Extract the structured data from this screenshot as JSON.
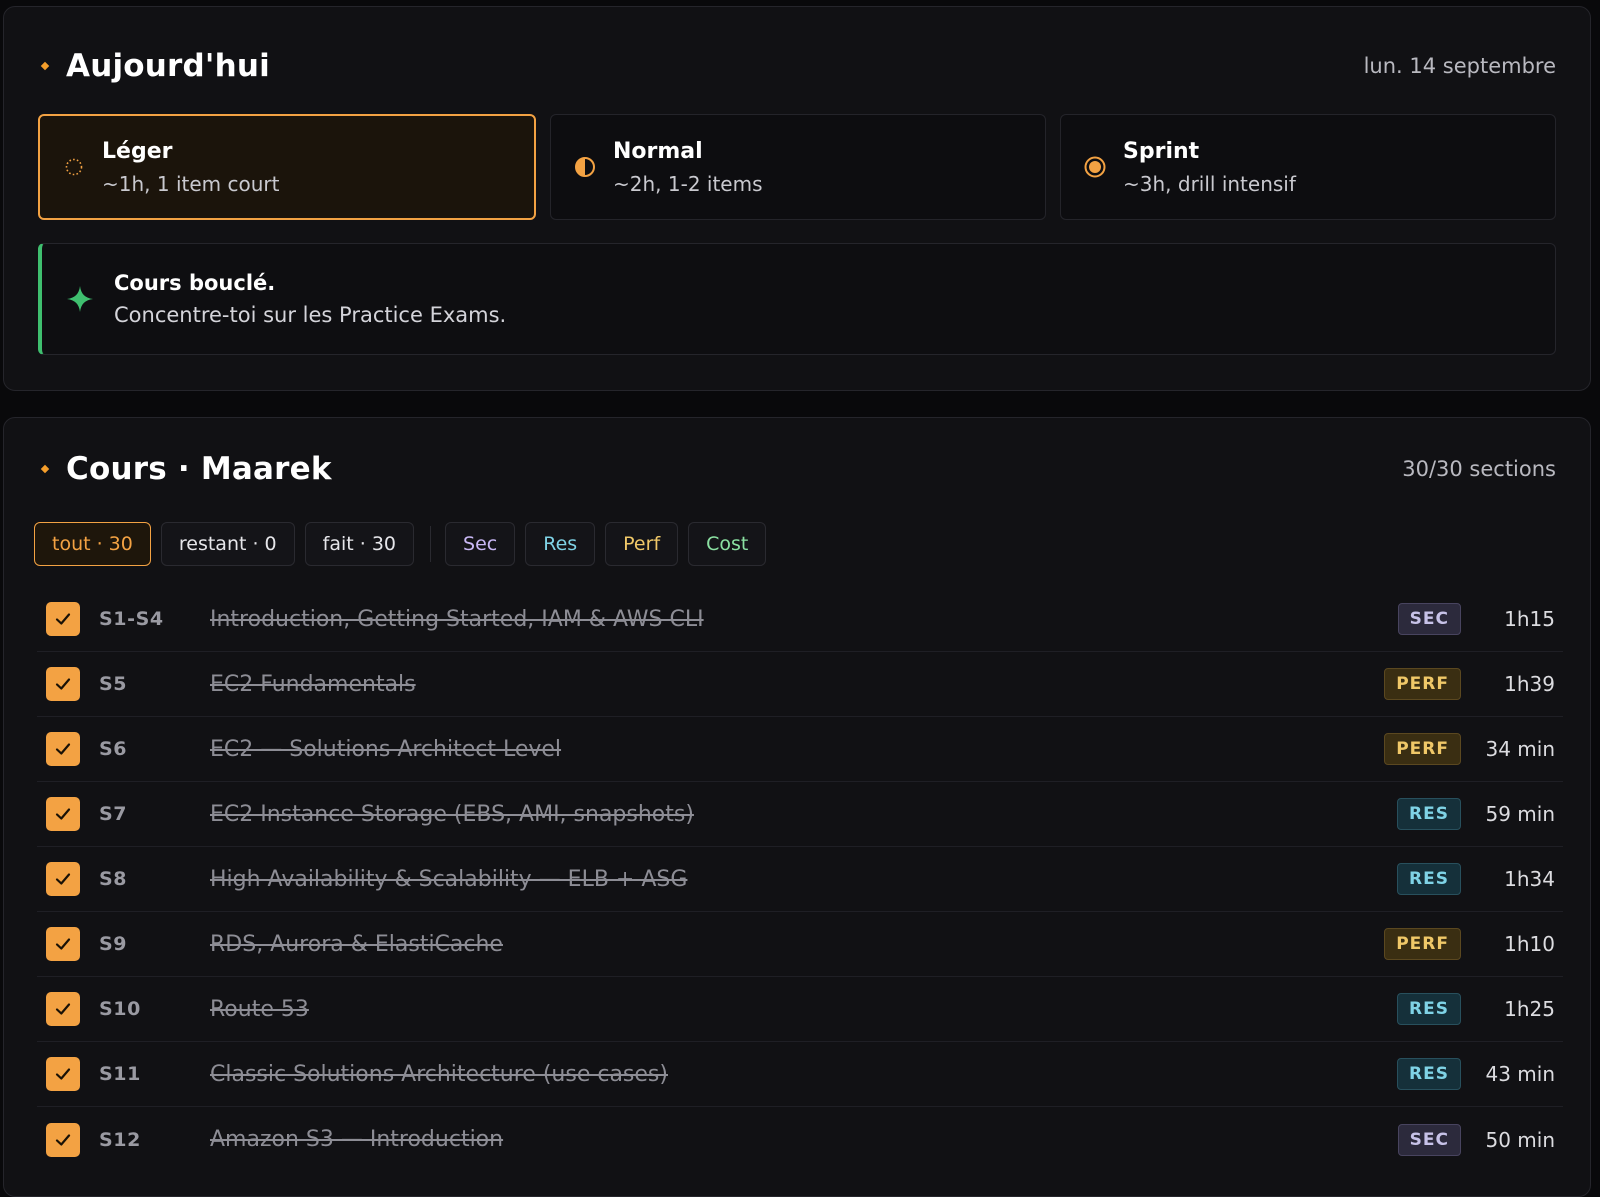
{
  "today": {
    "title": "Aujourd'hui",
    "date": "lun. 14 septembre",
    "modes": [
      {
        "name": "Léger",
        "desc": "~1h, 1 item court",
        "icon": "dotted-circle-icon",
        "active": true
      },
      {
        "name": "Normal",
        "desc": "~2h, 1-2 items",
        "icon": "half-circle-icon",
        "active": false
      },
      {
        "name": "Sprint",
        "desc": "~3h, drill intensif",
        "icon": "filled-circle-icon",
        "active": false
      }
    ],
    "callout": {
      "title": "Cours bouclé.",
      "text": "Concentre-toi sur les Practice Exams.",
      "icon": "sparkle-icon"
    }
  },
  "course": {
    "title": "Cours · Maarek",
    "meta": "30/30 sections",
    "filters": {
      "all": "tout · 30",
      "remaining": "restant · 0",
      "done": "fait · 30",
      "sec": "Sec",
      "res": "Res",
      "perf": "Perf",
      "cost": "Cost"
    },
    "rows": [
      {
        "id": "S1-S4",
        "title": "Introduction, Getting Started, IAM & AWS CLI",
        "badge": "SEC",
        "duration": "1h15"
      },
      {
        "id": "S5",
        "title": "EC2 Fundamentals",
        "badge": "PERF",
        "duration": "1h39"
      },
      {
        "id": "S6",
        "title": "EC2 — Solutions Architect Level",
        "badge": "PERF",
        "duration": "34 min"
      },
      {
        "id": "S7",
        "title": "EC2 Instance Storage (EBS, AMI, snapshots)",
        "badge": "RES",
        "duration": "59 min"
      },
      {
        "id": "S8",
        "title": "High Availability & Scalability — ELB + ASG",
        "badge": "RES",
        "duration": "1h34"
      },
      {
        "id": "S9",
        "title": "RDS, Aurora & ElastiCache",
        "badge": "PERF",
        "duration": "1h10"
      },
      {
        "id": "S10",
        "title": "Route 53",
        "badge": "RES",
        "duration": "1h25"
      },
      {
        "id": "S11",
        "title": "Classic Solutions Architecture (use cases)",
        "badge": "RES",
        "duration": "43 min"
      },
      {
        "id": "S12",
        "title": "Amazon S3 — Introduction",
        "badge": "SEC",
        "duration": "50 min"
      }
    ]
  },
  "colors": {
    "accent": "#f3a243",
    "success": "#3fbf6f",
    "background": "#09090b",
    "panel": "#111114"
  }
}
